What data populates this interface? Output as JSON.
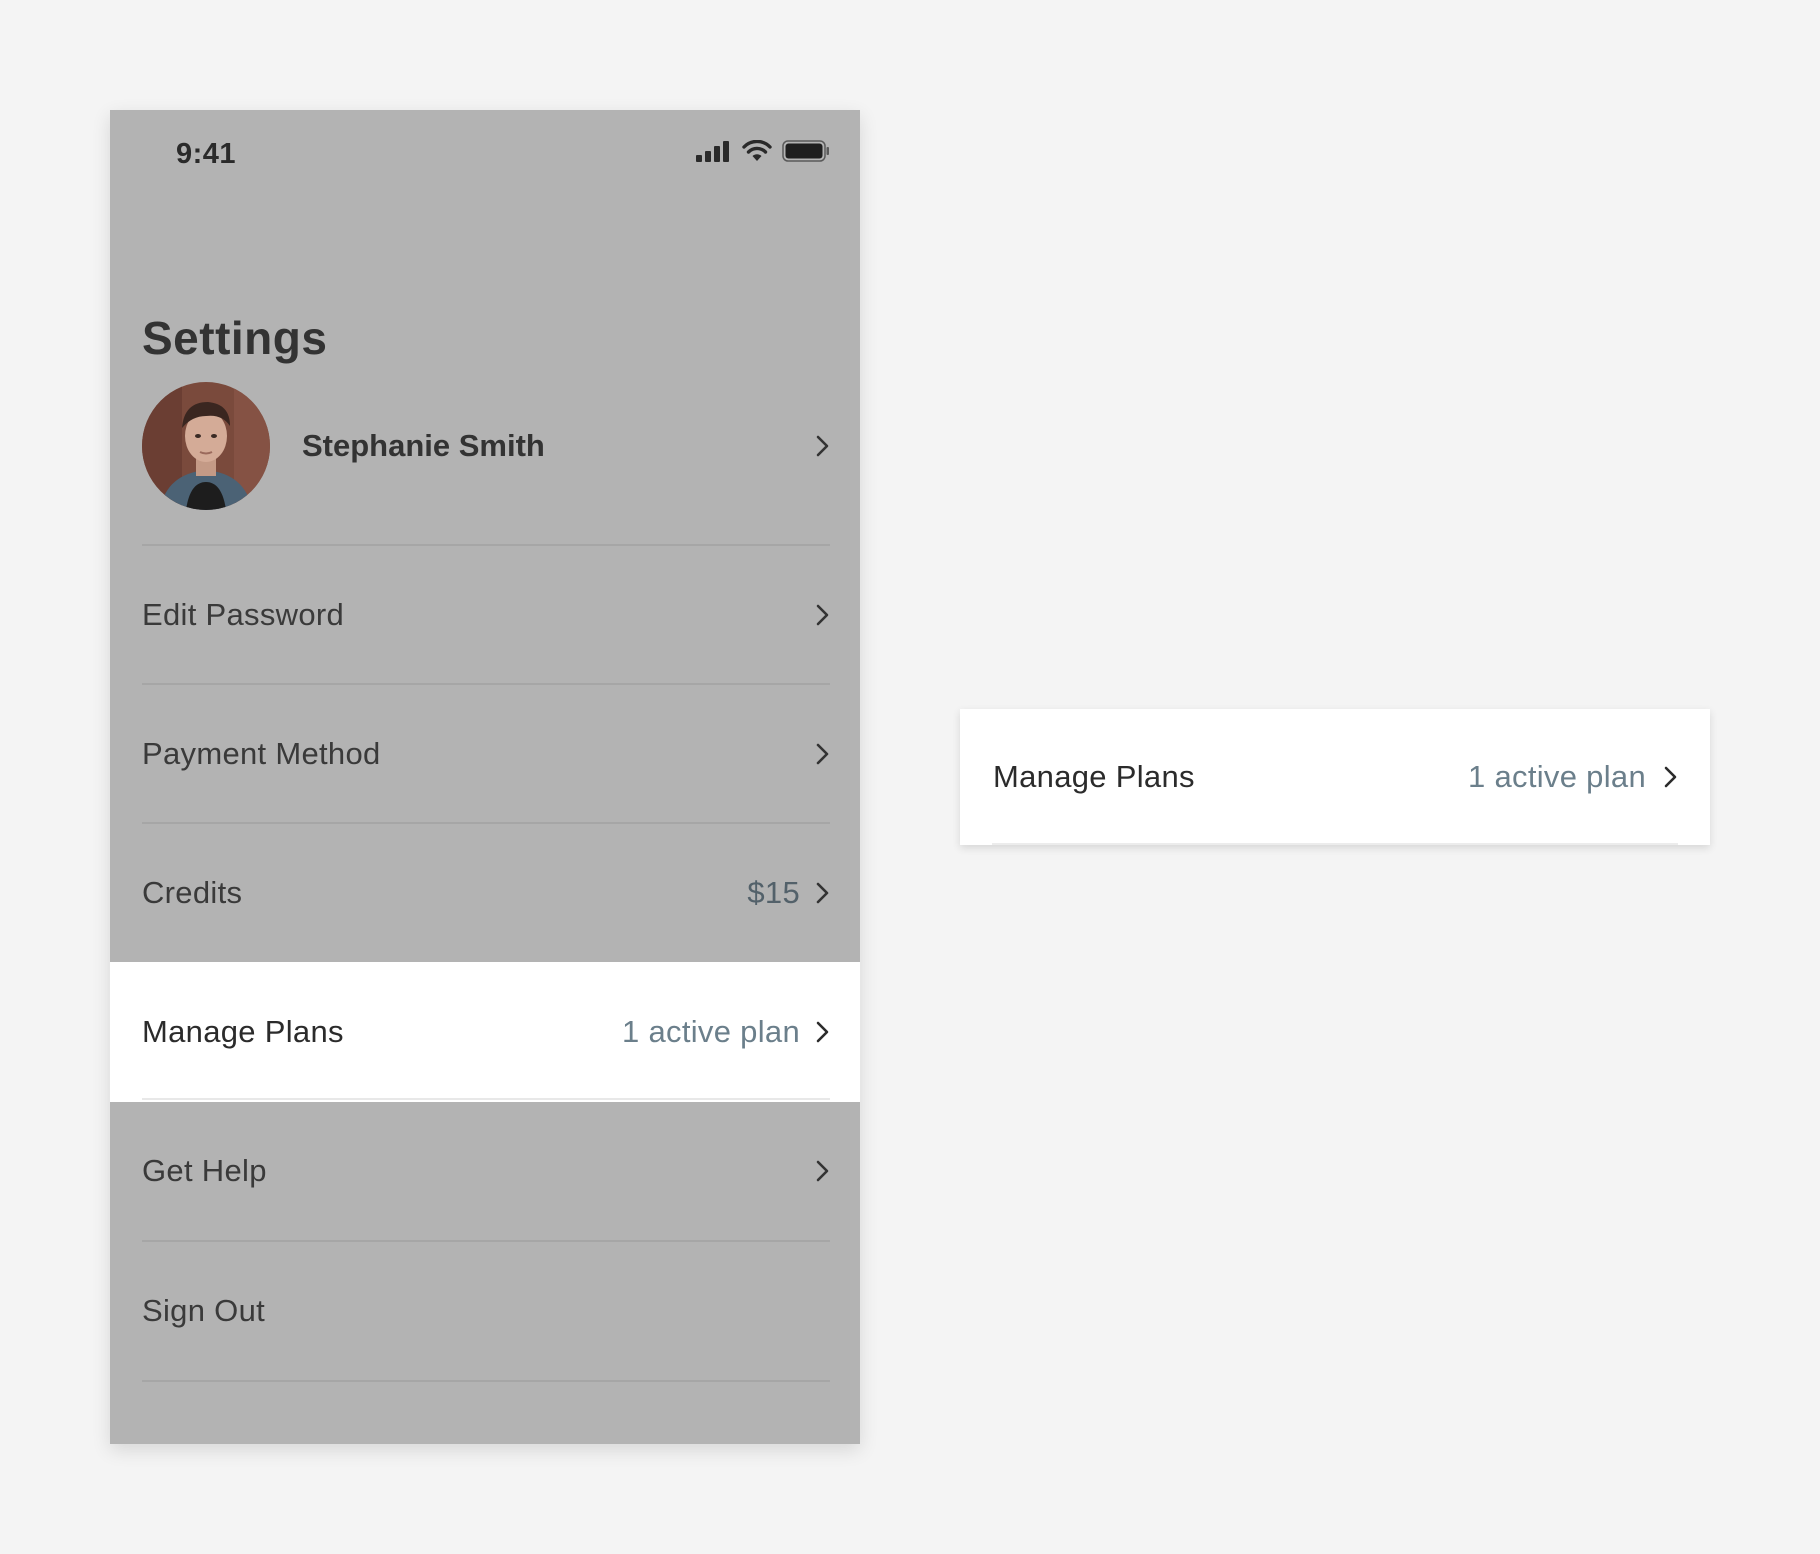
{
  "status_bar": {
    "time": "9:41",
    "icons": [
      "signal-icon",
      "wifi-icon",
      "battery-icon"
    ]
  },
  "header": {
    "title": "Settings"
  },
  "profile": {
    "name": "Stephanie Smith"
  },
  "settings_items": [
    {
      "label": "Edit Password",
      "value": ""
    },
    {
      "label": "Payment Method",
      "value": ""
    },
    {
      "label": "Credits",
      "value": "$15"
    },
    {
      "label": "Manage Plans",
      "value": "1 active plan",
      "highlighted": true
    },
    {
      "label": "Get Help",
      "value": ""
    },
    {
      "label": "Sign Out",
      "value": ""
    }
  ],
  "detail_card": {
    "label": "Manage Plans",
    "value": "1 active plan"
  },
  "colors": {
    "background": "#f4f4f4",
    "overlay": "#b3b3b3",
    "highlight": "#ffffff",
    "value_text": "#6b7f8b"
  }
}
